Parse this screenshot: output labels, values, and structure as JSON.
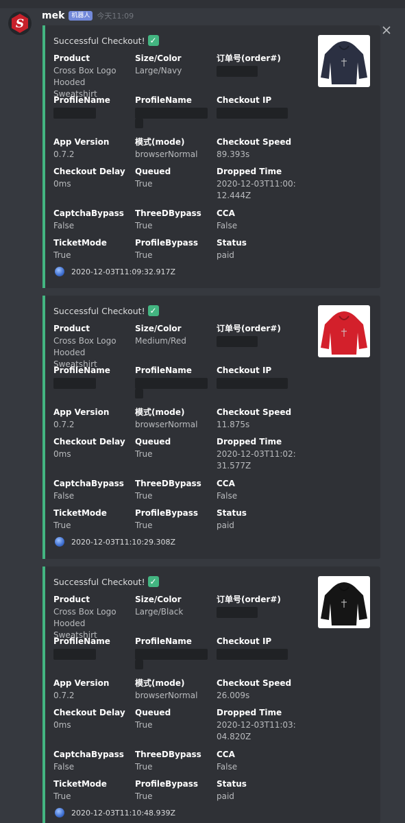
{
  "author": {
    "name": "mek",
    "badge": "机器人",
    "time": "今天11:09"
  },
  "close_icon": "close-icon",
  "fields_labels": {
    "product": "Product",
    "size": "Size/Color",
    "order": "订单号(order#)",
    "profile": "ProfileName",
    "profile2": "ProfileName",
    "ip": "Checkout IP",
    "app": "App Version",
    "mode": "模式(mode)",
    "speed": "Checkout Speed",
    "delay": "Checkout Delay",
    "queued": "Queued",
    "dropped": "Dropped Time",
    "captcha": "CaptchaBypass",
    "threeD": "ThreeDBypass",
    "cca": "CCA",
    "ticket": "TicketMode",
    "pbypass": "ProfileBypass",
    "status": "Status"
  },
  "embeds": [
    {
      "title": "Successful Checkout!",
      "accent": "#43b581",
      "thumb_color": "#2b3042",
      "product": "Cross Box Logo Hooded Sweatshirt",
      "size": "Large/Navy",
      "app": "0.7.2",
      "mode": "browserNormal",
      "speed": "89.393s",
      "delay": "0ms",
      "queued": "True",
      "dropped": "2020-12-03T11:00:12.444Z",
      "captcha": "False",
      "threeD": "True",
      "cca": "False",
      "ticket": "True",
      "pbypass": "True",
      "status": "paid",
      "footer": "2020-12-03T11:09:32.917Z"
    },
    {
      "title": "Successful Checkout!",
      "accent": "#43b581",
      "thumb_color": "#d3202b",
      "product": "Cross Box Logo Hooded Sweatshirt",
      "size": "Medium/Red",
      "app": "0.7.2",
      "mode": "browserNormal",
      "speed": "11.875s",
      "delay": "0ms",
      "queued": "True",
      "dropped": "2020-12-03T11:02:31.577Z",
      "captcha": "False",
      "threeD": "True",
      "cca": "False",
      "ticket": "True",
      "pbypass": "True",
      "status": "paid",
      "footer": "2020-12-03T11:10:29.308Z"
    },
    {
      "title": "Successful Checkout!",
      "accent": "#43b581",
      "thumb_color": "#151515",
      "product": "Cross Box Logo Hooded Sweatshirt",
      "size": "Large/Black",
      "app": "0.7.2",
      "mode": "browserNormal",
      "speed": "26.009s",
      "delay": "0ms",
      "queued": "True",
      "dropped": "2020-12-03T11:03:04.820Z",
      "captcha": "False",
      "threeD": "True",
      "cca": "False",
      "ticket": "True",
      "pbypass": "True",
      "status": "paid",
      "footer": "2020-12-03T11:10:48.939Z"
    }
  ]
}
